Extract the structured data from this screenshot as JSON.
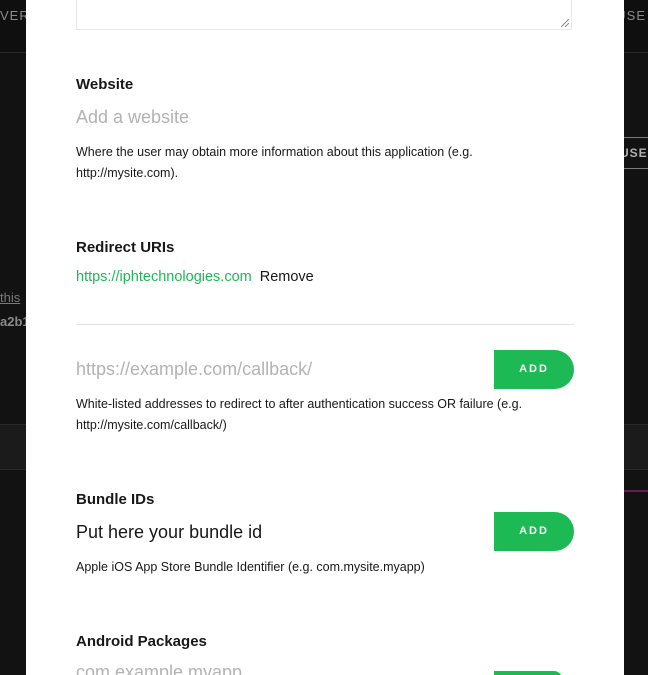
{
  "background": {
    "nav_left": "VER",
    "nav_right": "USE",
    "button_right": "USE",
    "link_left": "this",
    "code_left": "a2b1"
  },
  "modal": {
    "website": {
      "label": "Website",
      "placeholder": "Add a website",
      "help": "Where the user may obtain more information about this application (e.g. http://mysite.com)."
    },
    "redirect": {
      "label": "Redirect URIs",
      "uris": [
        {
          "url": "https://iphtechnologies.com",
          "remove_label": "Remove"
        }
      ],
      "placeholder": "https://example.com/callback/",
      "add_label": "ADD",
      "help": "White-listed addresses to redirect to after authentication success OR failure (e.g. http://mysite.com/callback/)"
    },
    "bundle": {
      "label": "Bundle IDs",
      "placeholder": "Put here your bundle id",
      "add_label": "ADD",
      "help": "Apple iOS App Store Bundle Identifier (e.g. com.mysite.myapp)"
    },
    "android": {
      "label": "Android Packages",
      "placeholder": "com.example.myapp"
    }
  },
  "colors": {
    "accent_green": "#1db954",
    "text_dark": "#181818",
    "placeholder_gray": "#b3b3b3"
  }
}
